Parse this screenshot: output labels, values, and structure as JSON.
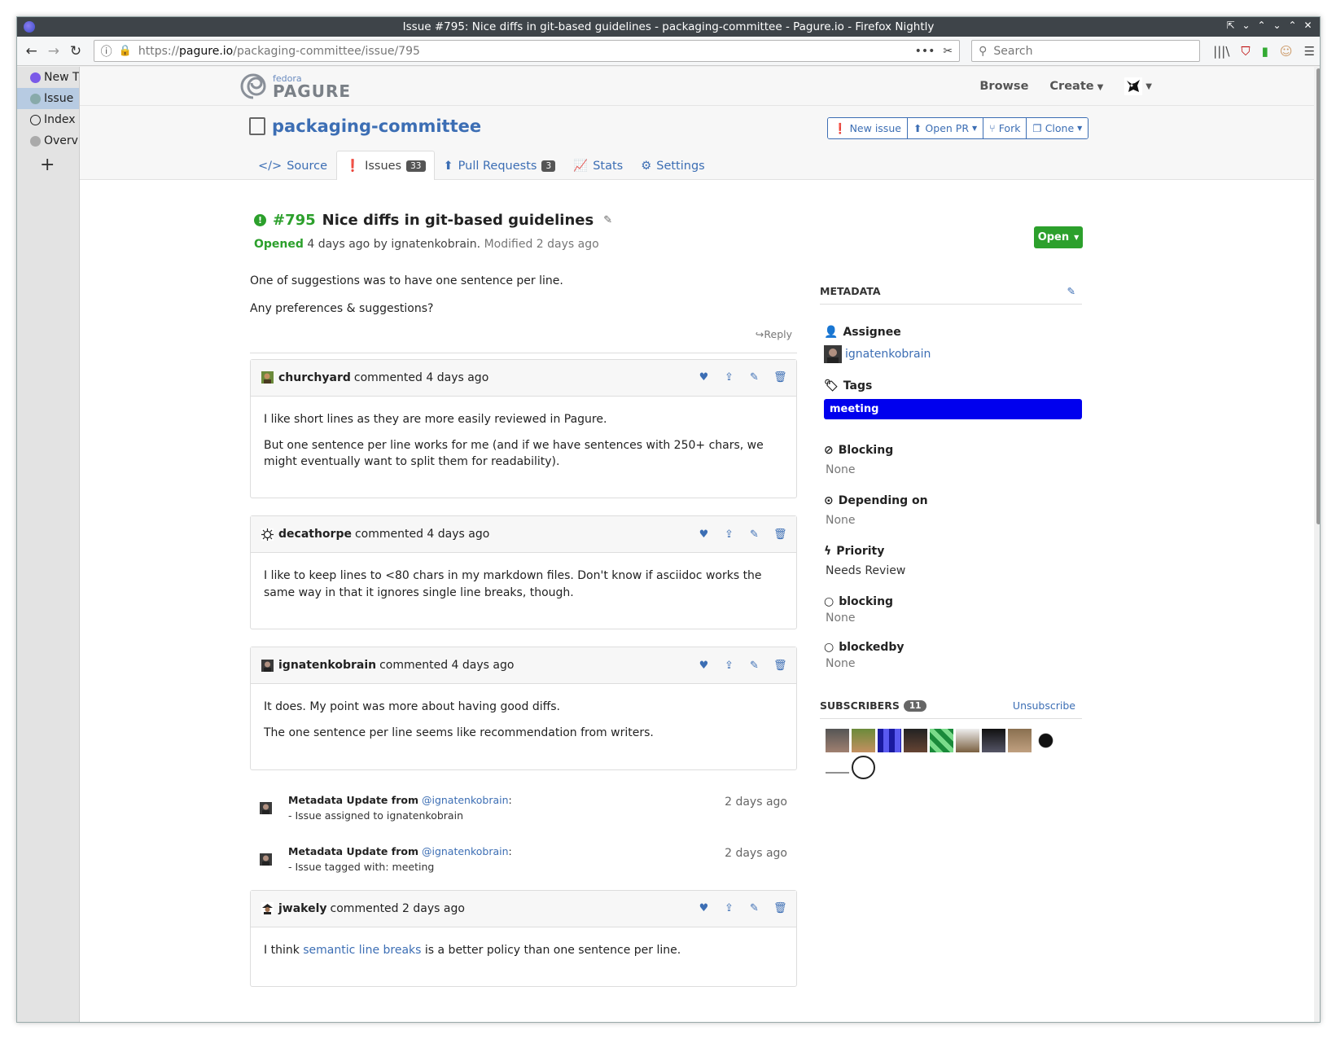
{
  "window": {
    "title": "Issue #795: Nice diffs in git-based guidelines - packaging-committee - Pagure.io - Firefox Nightly"
  },
  "browser": {
    "url_prefix": "https://",
    "url_domain": "pagure.io",
    "url_path": "/packaging-committee/issue/795",
    "search_placeholder": "Search"
  },
  "sidebar": {
    "tabs": [
      {
        "label": "New T"
      },
      {
        "label": "Issue"
      },
      {
        "label": "Index"
      },
      {
        "label": "Overv"
      }
    ]
  },
  "site": {
    "logo_small": "fedora",
    "logo_main": "PAGURE",
    "nav": {
      "browse": "Browse",
      "create": "Create"
    }
  },
  "repo": {
    "name": "packaging-committee",
    "buttons": {
      "new_issue": "New issue",
      "open_pr": "Open PR",
      "fork": "Fork",
      "clone": "Clone"
    },
    "tabs": [
      {
        "label": "Source"
      },
      {
        "label": "Issues",
        "count": "33"
      },
      {
        "label": "Pull Requests",
        "count": "3"
      },
      {
        "label": "Stats"
      },
      {
        "label": "Settings"
      }
    ]
  },
  "issue": {
    "number": "#795",
    "title": "Nice diffs in git-based guidelines",
    "opened_label": "Opened",
    "opened_rest": "4 days ago by ignatenkobrain.",
    "modified": "Modified 2 days ago",
    "status": "Open",
    "description": [
      "One of suggestions was to have one sentence per line.",
      "Any preferences & suggestions?"
    ],
    "reply": "Reply"
  },
  "comments": [
    {
      "user": "churchyard",
      "when": "commented 4 days ago",
      "paragraphs": [
        "I like short lines as they are more easily reviewed in Pagure.",
        "But one sentence per line works for me (and if we have sentences with 250+ chars, we might eventually want to split them for readability)."
      ]
    },
    {
      "user": "decathorpe",
      "when": "commented 4 days ago",
      "paragraphs": [
        "I like to keep lines to <80 chars in my markdown files. Don't know if asciidoc works the same way in that it ignores single line breaks, though."
      ]
    },
    {
      "user": "ignatenkobrain",
      "when": "commented 4 days ago",
      "paragraphs": [
        "It does. My point was more about having good diffs.",
        "The one sentence per line seems like recommendation from writers."
      ]
    }
  ],
  "metadata_updates": [
    {
      "label": "Metadata Update from",
      "user": "@ignatenkobrain",
      "colon": ":",
      "detail": "- Issue assigned to ignatenkobrain",
      "ago": "2 days ago"
    },
    {
      "label": "Metadata Update from",
      "user": "@ignatenkobrain",
      "colon": ":",
      "detail": "- Issue tagged with: meeting",
      "ago": "2 days ago"
    }
  ],
  "last_comment": {
    "user": "jwakely",
    "when": "commented 2 days ago",
    "pre": "I think ",
    "link": "semantic line breaks",
    "post": " is a better policy than one sentence per line."
  },
  "metadata": {
    "heading": "METADATA",
    "assignee_label": "Assignee",
    "assignee": "ignatenkobrain",
    "tags_label": "Tags",
    "tag": "meeting",
    "tag_color": "#0000ee",
    "blocking_label": "Blocking",
    "blocking": "None",
    "depending_label": "Depending on",
    "depending": "None",
    "priority_label": "Priority",
    "priority": "Needs Review",
    "blocking2_label": "blocking",
    "blocking2": "None",
    "blockedby_label": "blockedby",
    "blockedby": "None",
    "subscribers_label": "SUBSCRIBERS",
    "subscribers_count": "11",
    "unsubscribe": "Unsubscribe"
  },
  "colors": {
    "accent": "#3c6eb4",
    "open_green": "#2ca02c"
  }
}
